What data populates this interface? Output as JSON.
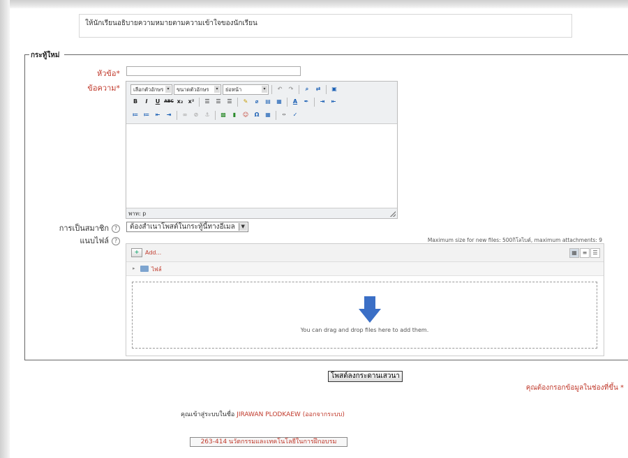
{
  "intro_text": "ให้นักเรียนอธิบายความหมายตามความเข้าใจของนักเรียน",
  "fieldset_legend": "กระทู้ใหม่",
  "form": {
    "subject_label": "หัวข้อ",
    "message_label": "ข้อความ",
    "subscription_label": "การเป็นสมาชิก",
    "attachment_label": "แนบไฟล์",
    "required_mark": "*",
    "subject_value": "",
    "subscription_value": "ต้องสำเนาโพสต์ในกระทู้นี้ทางอีเมล"
  },
  "editor": {
    "font_family": "เลือกตัวอักษร",
    "font_size": "ขนาดตัวอักษร",
    "format": "ย่อหน้า",
    "path": "พาท: p",
    "row2_buttons": [
      "B",
      "I",
      "U",
      "ABC",
      "x₂",
      "x²"
    ]
  },
  "file_picker": {
    "max_size_note": "Maximum size for new files: 500กิโลไบต์, maximum attachments: 9",
    "add_label": "Add...",
    "folder_name": "ไฟล์",
    "drop_text": "You can drag and drop files here to add them."
  },
  "buttons": {
    "submit": "โพสต์ลงกระดานเสวนา"
  },
  "required_note": "คุณต้องกรอกข้อมูลในช่องที่ขึ้น *",
  "login": {
    "prefix": "คุณเข้าสู่ระบบในชื่อ",
    "user": "JIRAWAN PLODKAEW",
    "logout": "(ออกจากระบบ)"
  },
  "course_link": "263-414 นวัตกรรมและเทคโนโลยีในการฝึกอบรม",
  "colors": {
    "required_red": "#c0392b",
    "folder_blue": "#7da4cf",
    "arrow_blue": "#3b6fc6"
  }
}
